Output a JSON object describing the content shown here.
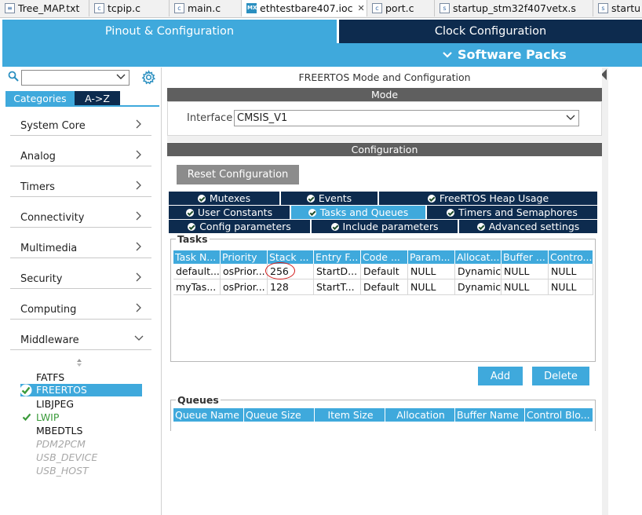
{
  "editor_tabs": [
    {
      "label": "Tree_MAP.txt",
      "icon": "text-file-icon",
      "active": false
    },
    {
      "label": "tcpip.c",
      "icon": "c-file-icon",
      "active": false
    },
    {
      "label": "main.c",
      "icon": "c-file-icon",
      "active": false
    },
    {
      "label": "ethtestbare407.ioc",
      "icon": "mx-file-icon",
      "icon_text": "MX",
      "active": true
    },
    {
      "label": "port.c",
      "icon": "c-file-icon",
      "active": false
    },
    {
      "label": "startup_stm32f407vetx.s",
      "icon": "asm-file-icon",
      "active": false
    },
    {
      "label": "startu",
      "icon": "asm-file-icon",
      "active": false
    }
  ],
  "main_tabs": {
    "pinout": "Pinout & Configuration",
    "clock": "Clock Configuration"
  },
  "software_packs": "Software Packs",
  "left_panel": {
    "search": {
      "value": ""
    },
    "tabs": {
      "categories": "Categories",
      "az": "A->Z"
    },
    "categories": [
      {
        "label": "System Core",
        "expanded": false
      },
      {
        "label": "Analog",
        "expanded": false
      },
      {
        "label": "Timers",
        "expanded": false
      },
      {
        "label": "Connectivity",
        "expanded": false
      },
      {
        "label": "Multimedia",
        "expanded": false
      },
      {
        "label": "Security",
        "expanded": false
      },
      {
        "label": "Computing",
        "expanded": false
      },
      {
        "label": "Middleware",
        "expanded": true
      }
    ],
    "middleware_items": [
      {
        "label": "FATFS",
        "state": "normal",
        "checked": false
      },
      {
        "label": "FREERTOS",
        "state": "selected",
        "checked": true
      },
      {
        "label": "LIBJPEG",
        "state": "normal",
        "checked": false
      },
      {
        "label": "LWIP",
        "state": "enabled",
        "checked": true
      },
      {
        "label": "MBEDTLS",
        "state": "normal",
        "checked": false
      },
      {
        "label": "PDM2PCM",
        "state": "disabled",
        "checked": false
      },
      {
        "label": "USB_DEVICE",
        "state": "disabled",
        "checked": false
      },
      {
        "label": "USB_HOST",
        "state": "disabled",
        "checked": false
      }
    ]
  },
  "right_panel": {
    "title": "FREERTOS Mode and Configuration",
    "mode_header": "Mode",
    "interface_label": "Interface",
    "interface_value": "CMSIS_V1",
    "config_header": "Configuration",
    "reset_button": "Reset Configuration",
    "config_tabs_row1": [
      "Mutexes",
      "Events",
      "FreeRTOS Heap Usage"
    ],
    "config_tabs_row2": [
      "User Constants",
      "Tasks and Queues",
      "Timers and Semaphores"
    ],
    "config_tabs_row3": [
      "Config parameters",
      "Include parameters",
      "Advanced settings"
    ],
    "active_tab": "Tasks and Queues",
    "tasks": {
      "legend": "Tasks",
      "columns": [
        "Task N...",
        "Priority",
        "Stack ...",
        "Entry F...",
        "Code ...",
        "Param...",
        "Allocat...",
        "Buffer ...",
        "Contro..."
      ],
      "rows": [
        [
          "default...",
          "osPrior...",
          "256",
          "StartD...",
          "Default",
          "NULL",
          "Dynamic",
          "NULL",
          "NULL"
        ],
        [
          "myTas...",
          "osPrior...",
          "128",
          "StartT...",
          "Default",
          "NULL",
          "Dynamic",
          "NULL",
          "NULL"
        ]
      ],
      "highlighted_cell": "256"
    },
    "add_button": "Add",
    "delete_button": "Delete",
    "queues": {
      "legend": "Queues",
      "columns": [
        "Queue Name",
        "Queue Size",
        "Item Size",
        "Allocation",
        "Buffer Name",
        "Control Blo..."
      ]
    }
  },
  "colors": {
    "accent": "#3fa9dc",
    "navy": "#0d2b4e",
    "header_gray": "#5f5f5f",
    "button_gray": "#8c8c8c",
    "check_green": "#3a9a3a",
    "annotation_red": "#d21818"
  }
}
